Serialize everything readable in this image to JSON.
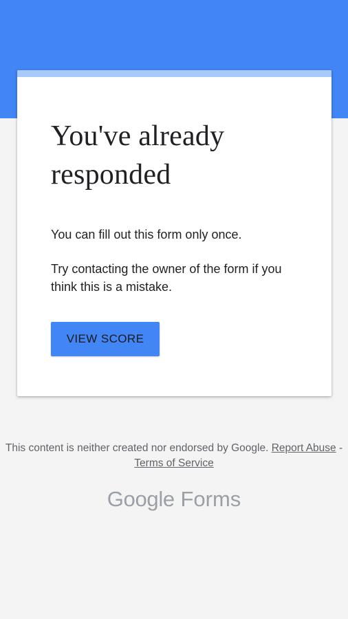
{
  "card": {
    "title": "You've already responded",
    "message_1": "You can fill out this form only once.",
    "message_2": "Try contacting the owner of the form if you think this is a mistake.",
    "button_label": "VIEW SCORE"
  },
  "footer": {
    "disclaimer": "This content is neither created nor endorsed by Google.",
    "report_abuse": "Report Abuse",
    "separator": " - ",
    "terms": "Terms of Service"
  },
  "brand": {
    "google": "Google",
    "forms": "Forms"
  },
  "colors": {
    "header_blue": "#4285f4",
    "accent_light_blue": "#a7c9fb",
    "background": "#f4f4f4",
    "text_dark": "#202124",
    "text_muted": "#5f6368",
    "brand_gray": "#9aa0a6"
  }
}
